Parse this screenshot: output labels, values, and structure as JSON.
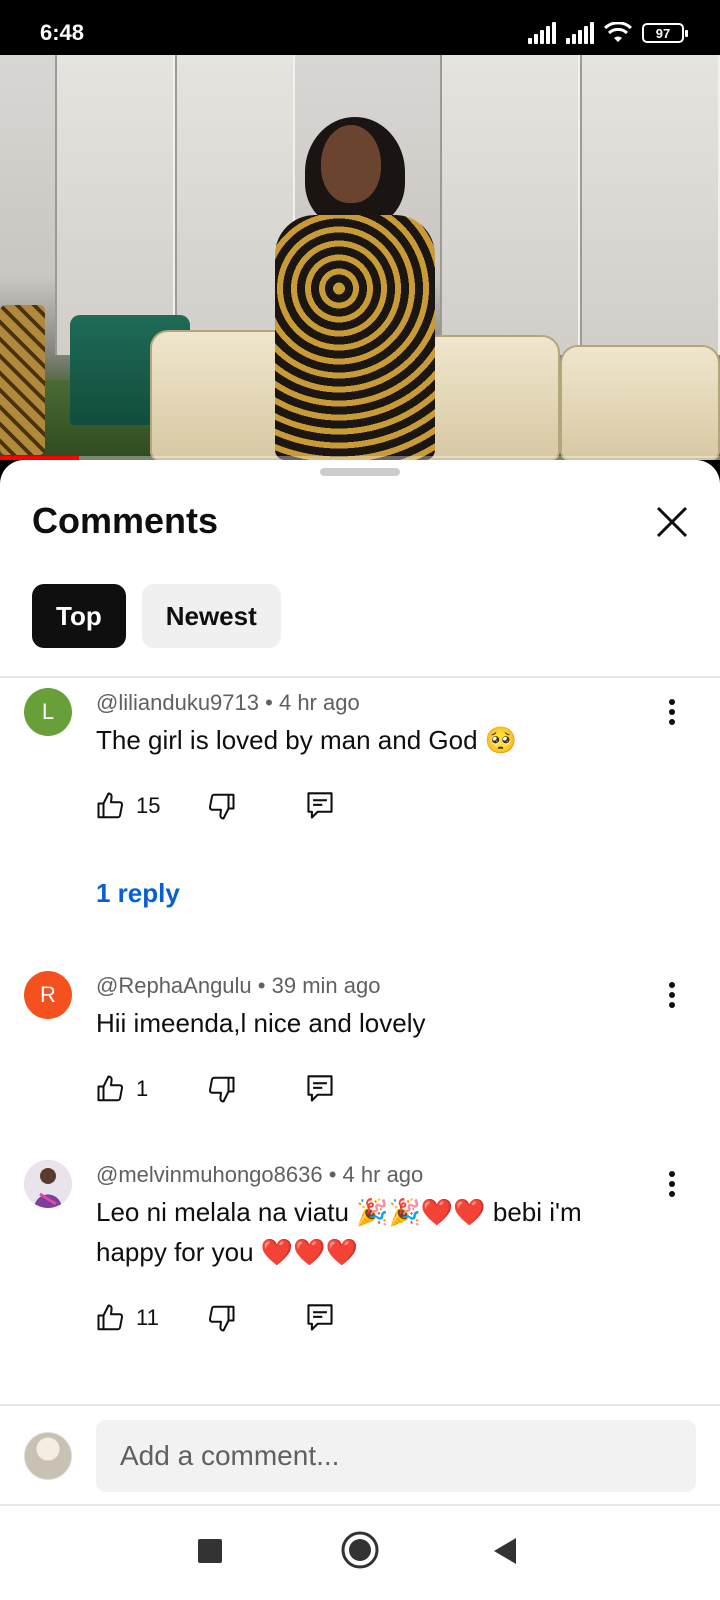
{
  "status_bar": {
    "time": "6:48",
    "battery": "97"
  },
  "video": {
    "progress_percent": 11
  },
  "sheet": {
    "title": "Comments",
    "tabs": [
      {
        "label": "Top",
        "active": true
      },
      {
        "label": "Newest",
        "active": false
      }
    ]
  },
  "comments": [
    {
      "avatar_letter": "L",
      "avatar_color": "#689f38",
      "handle": "@lilianduku9713",
      "time": "4 hr ago",
      "text": "The girl is loved by man and God 🥺",
      "likes": "15",
      "reply_label": "1 reply"
    },
    {
      "avatar_letter": "R",
      "avatar_color": "#f4511e",
      "handle": "@RephaAngulu",
      "time": "39 min ago",
      "text": "Hii imeenda,l nice and lovely",
      "likes": "1"
    },
    {
      "avatar_letter": "",
      "avatar_color": "#d8c7e0",
      "handle": "@melvinmuhongo8636",
      "time": "4 hr ago",
      "text": "Leo ni melala na viatu 🎉🎉❤️❤️ bebi i'm happy for you ❤️❤️❤️",
      "likes": "11"
    }
  ],
  "composer": {
    "placeholder": "Add a comment..."
  }
}
